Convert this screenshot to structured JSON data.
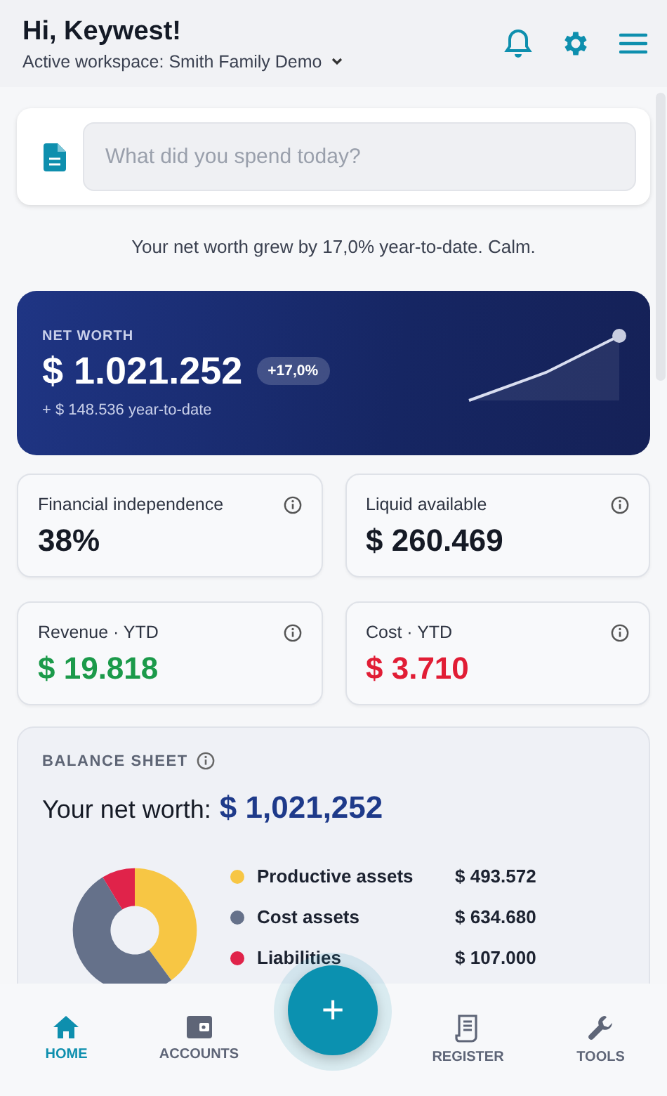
{
  "header": {
    "greeting": "Hi, Keywest!",
    "workspace": "Active workspace: Smith Family Demo"
  },
  "quick_entry": {
    "placeholder": "What did you spend today?"
  },
  "insight": "Your net worth grew by 17,0% year-to-date. Calm.",
  "net_worth": {
    "label": "NET WORTH",
    "value": "$ 1.021.252",
    "badge": "+17,0%",
    "subtext": "+ $ 148.536 year-to-date"
  },
  "tiles": [
    {
      "label": "Financial independence",
      "value": "38%",
      "color": "#151a25"
    },
    {
      "label": "Liquid available",
      "value": "$ 260.469",
      "color": "#151a25"
    },
    {
      "label": "Revenue · YTD",
      "value": "$ 19.818",
      "color": "#1b9a4a"
    },
    {
      "label": "Cost · YTD",
      "value": "$ 3.710",
      "color": "#e11d35"
    }
  ],
  "balance_sheet": {
    "title": "BALANCE SHEET",
    "lead": "Your net worth:",
    "total": "$ 1,021,252",
    "legend": [
      {
        "amount": "$ 493.572",
        "color": "#f7c644"
      },
      {
        "amount": "$ 634.680",
        "color": "#65718a"
      },
      {
        "amount": "$ 107.000",
        "color": "#e0234a"
      }
    ],
    "chart_data": {
      "type": "donut",
      "categories": [
        "Productive assets",
        "Cost assets",
        "Liabilities"
      ],
      "series": [
        {
          "values": [
            39.96,
            51.38,
            8.66
          ]
        }
      ]
    }
  },
  "fab": "+",
  "nav": [
    {
      "label": "HOME",
      "kind": "home",
      "selected": true
    },
    {
      "label": "ACCOUNTS",
      "kind": "wallet",
      "selected": false
    },
    {
      "label": "REGISTER",
      "kind": "receipt",
      "selected": false
    },
    {
      "label": "TOOLS",
      "kind": "wrench",
      "selected": false
    }
  ]
}
